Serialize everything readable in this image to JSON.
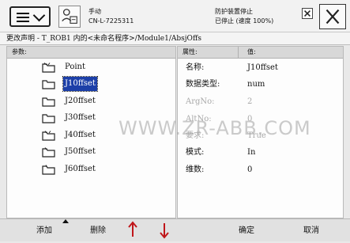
{
  "status": {
    "mode_label": "手动",
    "controller_id": "CN-L-7225311",
    "guard_stop": "防护装置停止",
    "state": "已停止 (速度 100%)"
  },
  "breadcrumb": "更改声明 - T_ROB1 内的<未命名程序>/Module1/AbsjOffs",
  "left_panel": {
    "header": "参数:",
    "items": [
      {
        "label": "Point"
      },
      {
        "label": "J10ffset"
      },
      {
        "label": "J20ffset"
      },
      {
        "label": "J30ffset"
      },
      {
        "label": "J40ffset"
      },
      {
        "label": "J50ffset"
      },
      {
        "label": "J60ffset"
      }
    ]
  },
  "right_panel": {
    "header_property": "属性:",
    "header_value": "值:",
    "rows": [
      {
        "name": "名称:",
        "value": "J10ffset"
      },
      {
        "name": "数据类型:",
        "value": "num"
      },
      {
        "name": "ArgNo:",
        "value": "2"
      },
      {
        "name": "AltNo:",
        "value": "0"
      },
      {
        "name": "要求:",
        "value": "True"
      },
      {
        "name": "模式:",
        "value": "In"
      },
      {
        "name": "维数:",
        "value": "0"
      }
    ]
  },
  "footer": {
    "add": "添加",
    "delete": "删除",
    "ok": "确定",
    "cancel": "取消"
  },
  "watermark": "WWW.ZR-ABB.COM",
  "colors": {
    "selection": "#1c3fa8"
  }
}
